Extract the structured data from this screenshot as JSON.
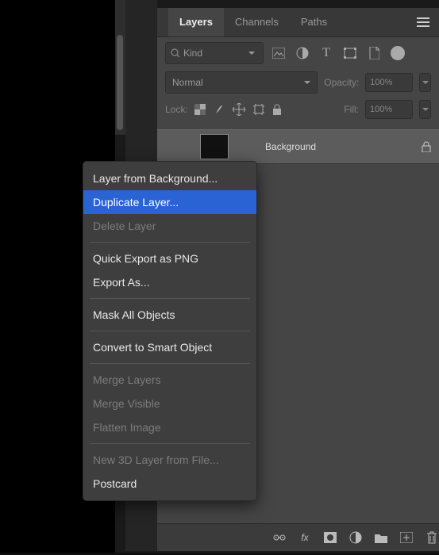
{
  "panel": {
    "tabs": [
      "Layers",
      "Channels",
      "Paths"
    ],
    "activeTab": 0,
    "filter": {
      "kindLabel": "Kind",
      "icons": [
        "image-icon",
        "adjustment-icon",
        "type-icon",
        "shape-icon",
        "smartobject-icon"
      ]
    },
    "blend": {
      "mode": "Normal",
      "opacityLabel": "Opacity:",
      "opacityValue": "100%"
    },
    "lock": {
      "label": "Lock:",
      "fillLabel": "Fill:",
      "fillValue": "100%"
    },
    "layer": {
      "name": "Background",
      "locked": true
    },
    "bottomIcons": [
      "link-icon",
      "fx-icon",
      "mask-icon",
      "adjustment-layer-icon",
      "group-icon",
      "new-layer-icon",
      "trash-icon"
    ]
  },
  "contextMenu": {
    "items": [
      {
        "label": "Layer from Background...",
        "enabled": true
      },
      {
        "label": "Duplicate Layer...",
        "enabled": true,
        "highlighted": true
      },
      {
        "label": "Delete Layer",
        "enabled": false
      },
      {
        "sep": true
      },
      {
        "label": "Quick Export as PNG",
        "enabled": true
      },
      {
        "label": "Export As...",
        "enabled": true
      },
      {
        "sep": true
      },
      {
        "label": "Mask All Objects",
        "enabled": true
      },
      {
        "sep": true
      },
      {
        "label": "Convert to Smart Object",
        "enabled": true
      },
      {
        "sep": true
      },
      {
        "label": "Merge Layers",
        "enabled": false
      },
      {
        "label": "Merge Visible",
        "enabled": false
      },
      {
        "label": "Flatten Image",
        "enabled": false
      },
      {
        "sep": true
      },
      {
        "label": "New 3D Layer from File...",
        "enabled": false
      },
      {
        "label": "Postcard",
        "enabled": true
      }
    ]
  },
  "colors": {
    "highlight": "#2a63d4"
  }
}
